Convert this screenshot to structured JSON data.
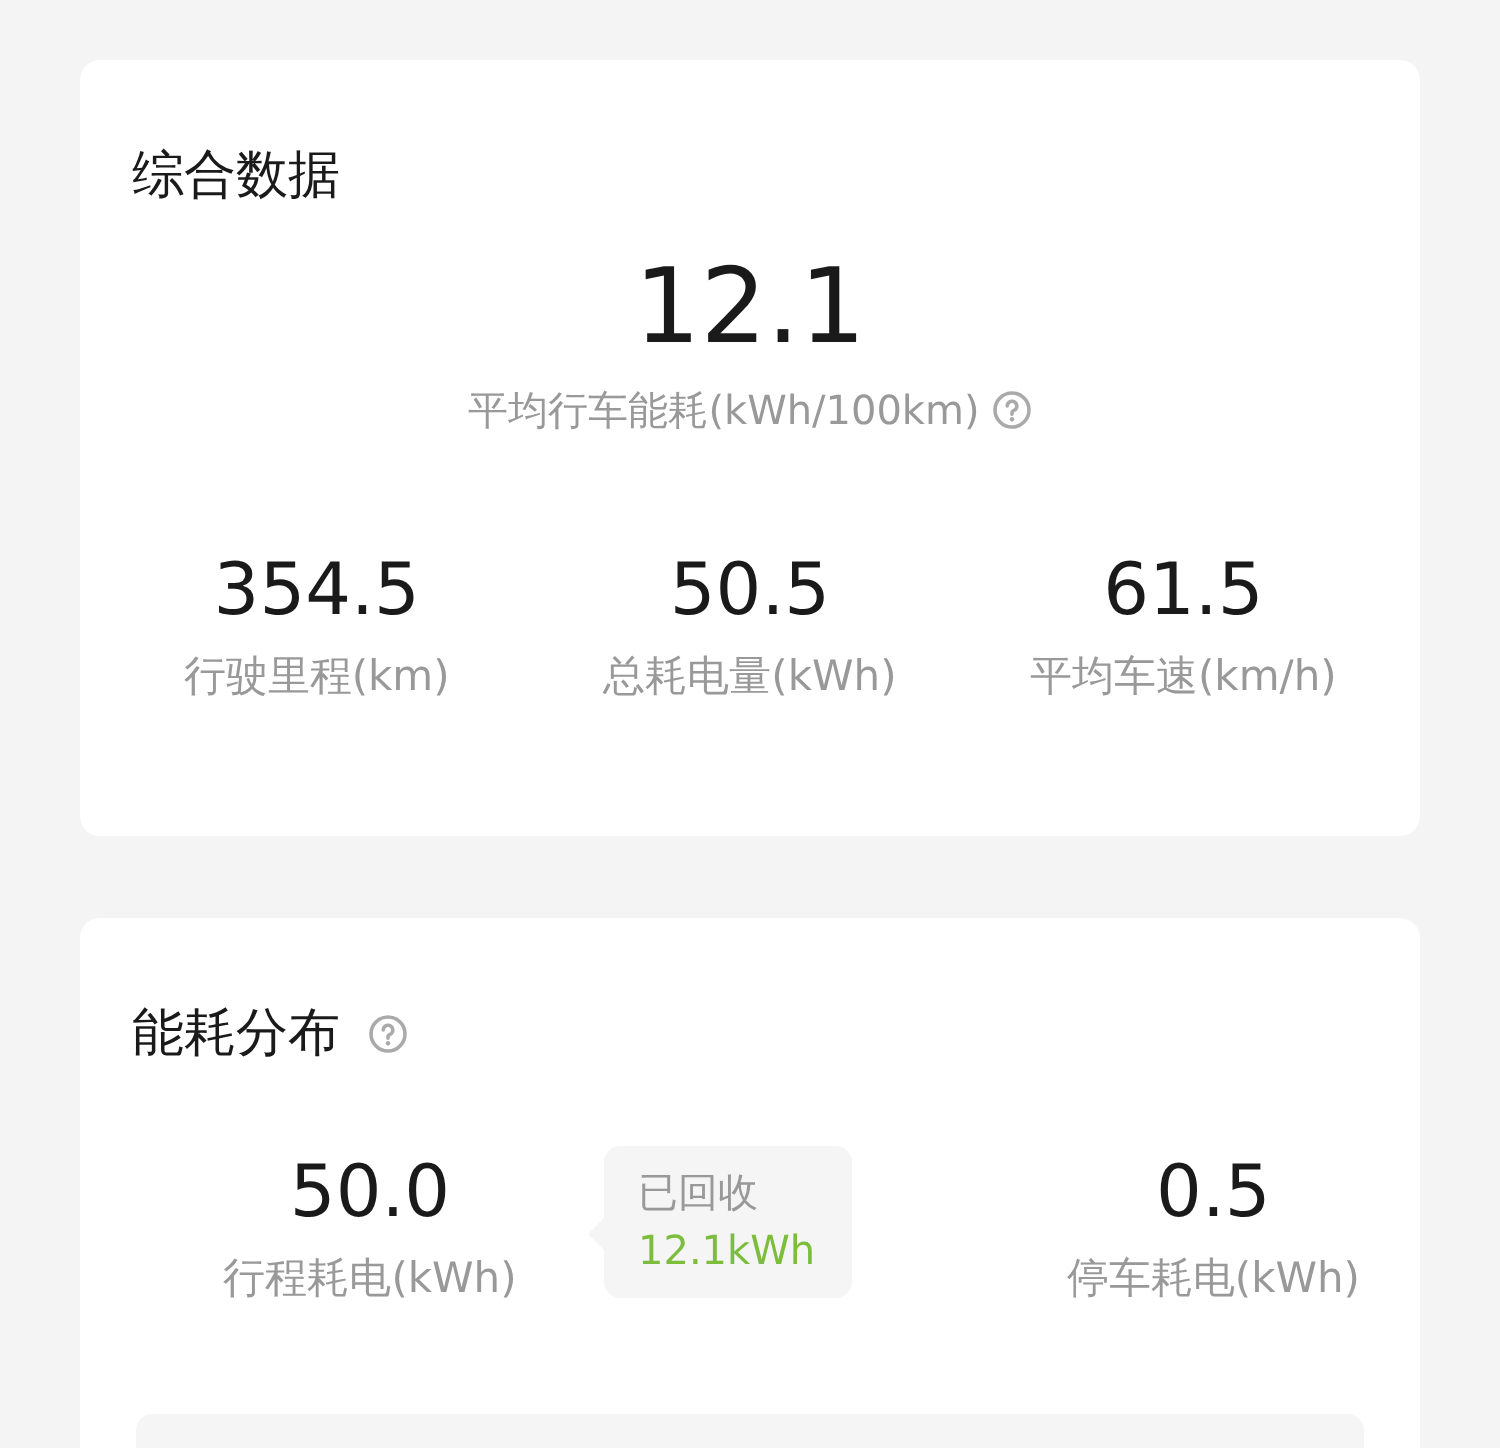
{
  "overview": {
    "title": "综合数据",
    "main": {
      "value": "12.1",
      "label": "平均行车能耗(kWh/100km)"
    },
    "stats": [
      {
        "value": "354.5",
        "label": "行驶里程(km)"
      },
      {
        "value": "50.5",
        "label": "总耗电量(kWh)"
      },
      {
        "value": "61.5",
        "label": "平均车速(km/h)"
      }
    ]
  },
  "distribution": {
    "title": "能耗分布",
    "items": [
      {
        "value": "50.0",
        "label": "行程耗电(kWh)"
      },
      {
        "value": "0.5",
        "label": "停车耗电(kWh)"
      }
    ],
    "recovered": {
      "label": "已回收",
      "value": "12.1kWh"
    }
  }
}
